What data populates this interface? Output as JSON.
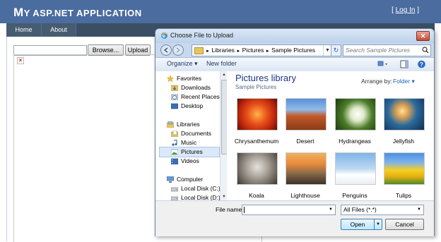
{
  "site": {
    "title_first_letter": "M",
    "title_rest": "Y ASP.NET A",
    "title_word2_rest": "PPLICATION",
    "login_open": "[ ",
    "login_link": "Log In",
    "login_close": " ]"
  },
  "menu": {
    "items": [
      "Home",
      "About"
    ]
  },
  "page": {
    "browse_label": "Browse...",
    "upload_label": "Upload",
    "broken_image_glyph": "×"
  },
  "dialog": {
    "title": "Choose File to Upload",
    "close_glyph": "✕",
    "breadcrumb": [
      "Libraries",
      "Pictures",
      "Sample Pictures"
    ],
    "breadcrumb_sep": "►",
    "search_placeholder": "Search Sample Pictures",
    "commands": {
      "organize": "Organize ▾",
      "new_folder": "New folder"
    },
    "nav": {
      "favorites_header": "Favorites",
      "favorites": [
        "Downloads",
        "Recent Places",
        "Desktop"
      ],
      "libraries_header": "Libraries",
      "libraries": [
        "Documents",
        "Music",
        "Pictures",
        "Videos"
      ],
      "computer_header": "Computer",
      "drives": [
        "Local Disk (C:)",
        "Local Disk (D:)"
      ]
    },
    "library": {
      "title": "Pictures library",
      "subtitle": "Sample Pictures",
      "arrange_label": "Arrange by:",
      "arrange_value": "Folder ▾",
      "files": [
        "Chrysanthemum",
        "Desert",
        "Hydrangeas",
        "Jellyfish",
        "Koala",
        "Lighthouse",
        "Penguins",
        "Tulips"
      ]
    },
    "file_name_label": "File name:",
    "file_name_value": "",
    "filter_value": "All Files (*.*)",
    "open_label": "Open",
    "cancel_label": "Cancel"
  },
  "colors": {
    "header": "#4b6c9e",
    "menu": "#3a4f63",
    "dialog_frame": "#c7d9ef",
    "library_title": "#1e3287"
  }
}
